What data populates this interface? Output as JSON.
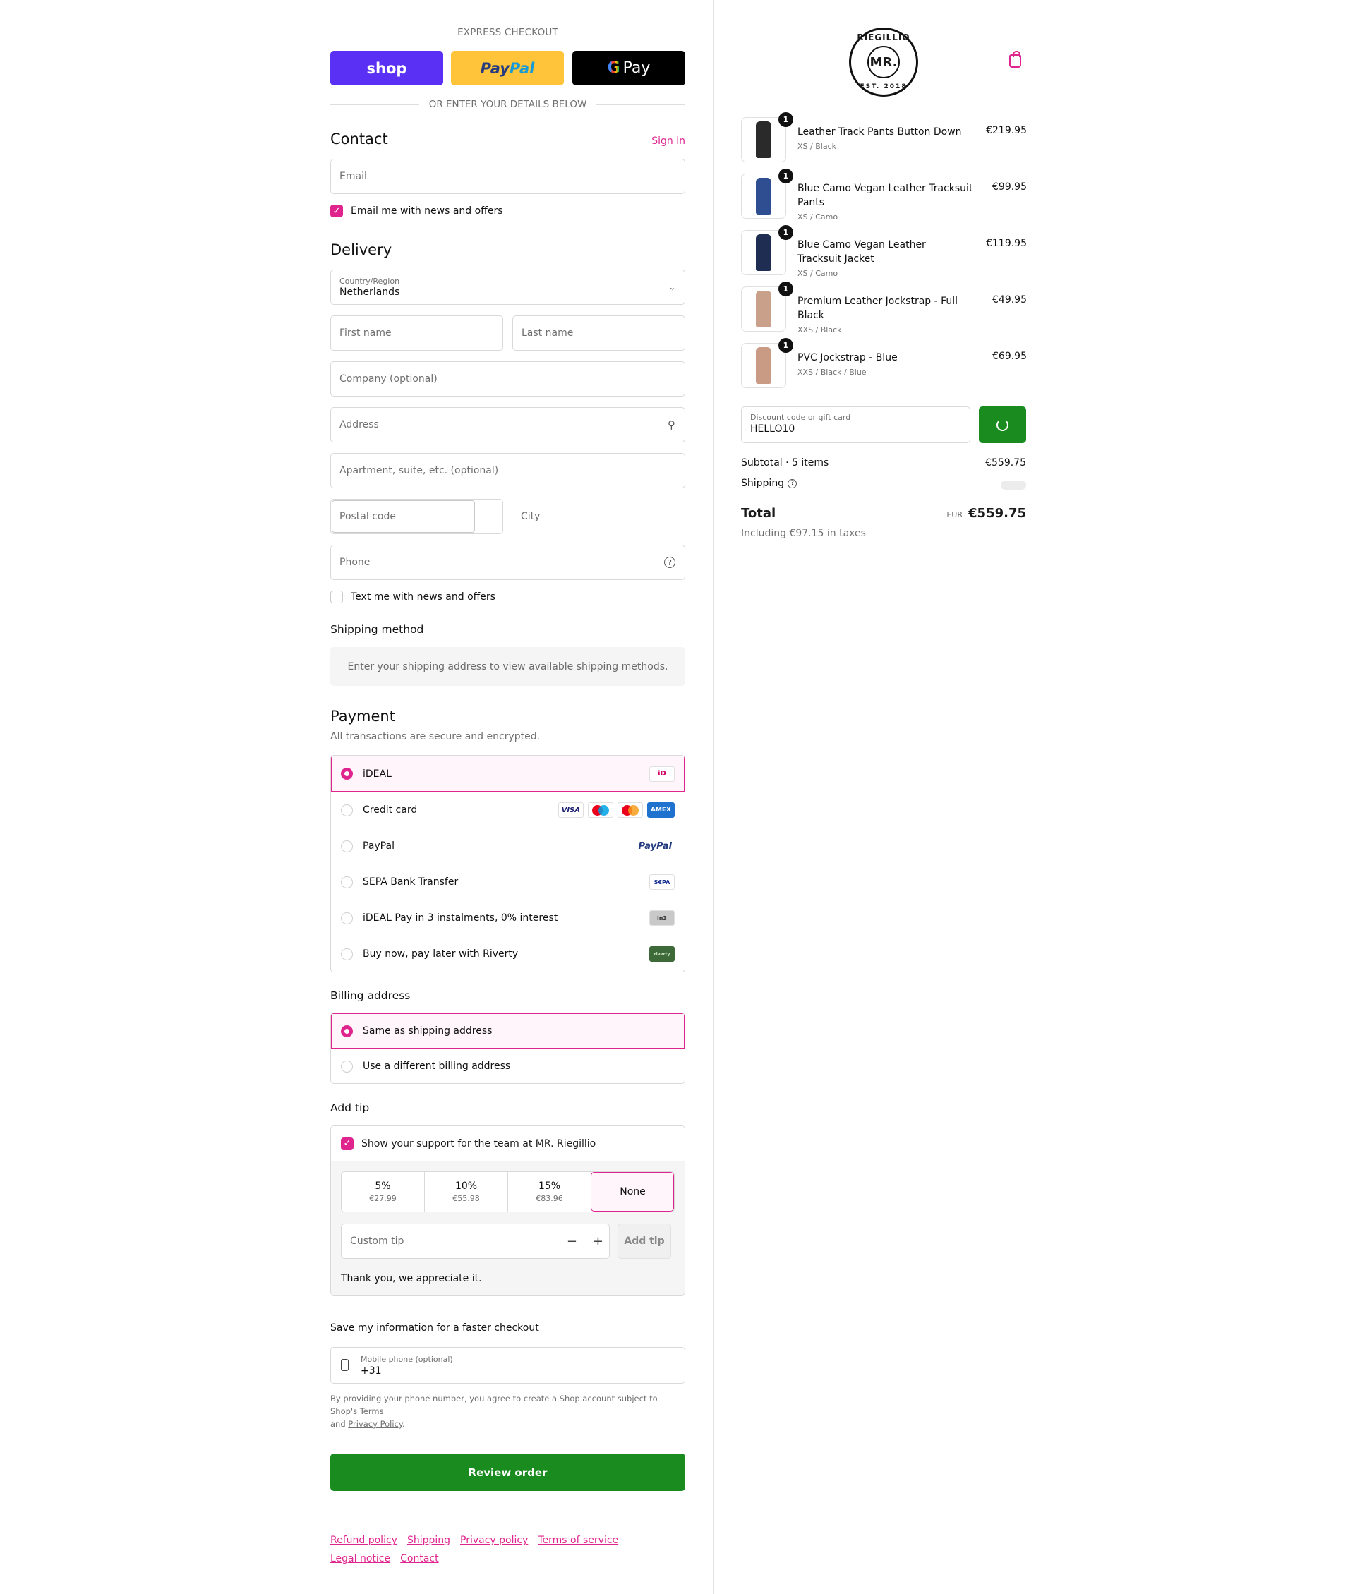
{
  "express": {
    "title": "EXPRESS CHECKOUT",
    "shop_label": "shop",
    "paypal_label_a": "Pay",
    "paypal_label_b": "Pal",
    "gpay_label": "Pay",
    "or_text": "OR ENTER YOUR DETAILS BELOW"
  },
  "contact": {
    "title": "Contact",
    "sign_in": "Sign in",
    "email_placeholder": "Email",
    "news_label": "Email me with news and offers",
    "news_checked": true
  },
  "delivery": {
    "title": "Delivery",
    "country_label": "Country/Region",
    "country_value": "Netherlands",
    "first_name": "First name",
    "last_name": "Last name",
    "company": "Company (optional)",
    "address": "Address",
    "apartment": "Apartment, suite, etc. (optional)",
    "postal": "Postal code",
    "city": "City",
    "phone": "Phone",
    "sms_label": "Text me with news and offers",
    "sms_checked": false
  },
  "shipping_method": {
    "title": "Shipping method",
    "message": "Enter your shipping address to view available shipping methods."
  },
  "payment": {
    "title": "Payment",
    "subtitle": "All transactions are secure and encrypted.",
    "methods": [
      {
        "label": "iDEAL",
        "selected": true
      },
      {
        "label": "Credit card",
        "selected": false
      },
      {
        "label": "PayPal",
        "selected": false
      },
      {
        "label": "SEPA Bank Transfer",
        "selected": false
      },
      {
        "label": "iDEAL Pay in 3 instalments, 0% interest",
        "selected": false
      },
      {
        "label": "Buy now, pay later with Riverty",
        "selected": false
      }
    ],
    "logos": {
      "ideal": "iD",
      "visa": "VISA",
      "amex": "AMEX",
      "paypal": "PayPal",
      "sepa": "S€PA",
      "in3": "in3",
      "riverty": "riverty"
    }
  },
  "billing": {
    "title": "Billing address",
    "options": [
      {
        "label": "Same as shipping address",
        "selected": true
      },
      {
        "label": "Use a different billing address",
        "selected": false
      }
    ]
  },
  "tip": {
    "title": "Add tip",
    "support_label": "Show your support for the team at MR. Riegillio",
    "support_checked": true,
    "options": [
      {
        "pct": "5%",
        "amount": "€27.99"
      },
      {
        "pct": "10%",
        "amount": "€55.98"
      },
      {
        "pct": "15%",
        "amount": "€83.96"
      },
      {
        "pct": "None",
        "amount": ""
      }
    ],
    "selected_index": 3,
    "custom_placeholder": "Custom tip",
    "add_label": "Add tip",
    "thanks": "Thank you, we appreciate it."
  },
  "save_info": {
    "title": "Save my information for a faster checkout",
    "phone_label": "Mobile phone (optional)",
    "phone_value": "+31",
    "legal_a": "By providing your phone number, you agree to create a Shop account subject to Shop's",
    "terms": "Terms",
    "legal_and": "and",
    "privacy": "Privacy Policy",
    "legal_end": "."
  },
  "review_label": "Review order",
  "footer": {
    "links": [
      "Refund policy",
      "Shipping",
      "Privacy policy",
      "Terms of service",
      "Legal notice",
      "Contact"
    ]
  },
  "brand": {
    "ring_top": "RIEGILLIO",
    "center": "MR.",
    "ring_bottom": "EST. 2018"
  },
  "cart": {
    "items": [
      {
        "name": "Leather Track Pants Button Down",
        "variant": "XS / Black",
        "price": "€219.95",
        "qty": "1",
        "color": "#2a2a2a"
      },
      {
        "name": "Blue Camo Vegan Leather Tracksuit Pants",
        "variant": "XS / Camo",
        "price": "€99.95",
        "qty": "1",
        "color": "#2f4e92"
      },
      {
        "name": "Blue Camo Vegan Leather Tracksuit Jacket",
        "variant": "XS / Camo",
        "price": "€119.95",
        "qty": "1",
        "color": "#1f2d52"
      },
      {
        "name": "Premium Leather Jockstrap - Full Black",
        "variant": "XXS / Black",
        "price": "€49.95",
        "qty": "1",
        "color": "#c9a089"
      },
      {
        "name": "PVC Jockstrap - Blue",
        "variant": "XXS / Black / Blue",
        "price": "€69.95",
        "qty": "1",
        "color": "#c99a84"
      }
    ],
    "discount_label": "Discount code or gift card",
    "discount_value": "HELLO10",
    "subtotal_label": "Subtotal · 5 items",
    "subtotal_value": "€559.75",
    "shipping_label": "Shipping",
    "total_label": "Total",
    "currency": "EUR",
    "total_value": "€559.75",
    "taxes": "Including €97.15 in taxes"
  }
}
